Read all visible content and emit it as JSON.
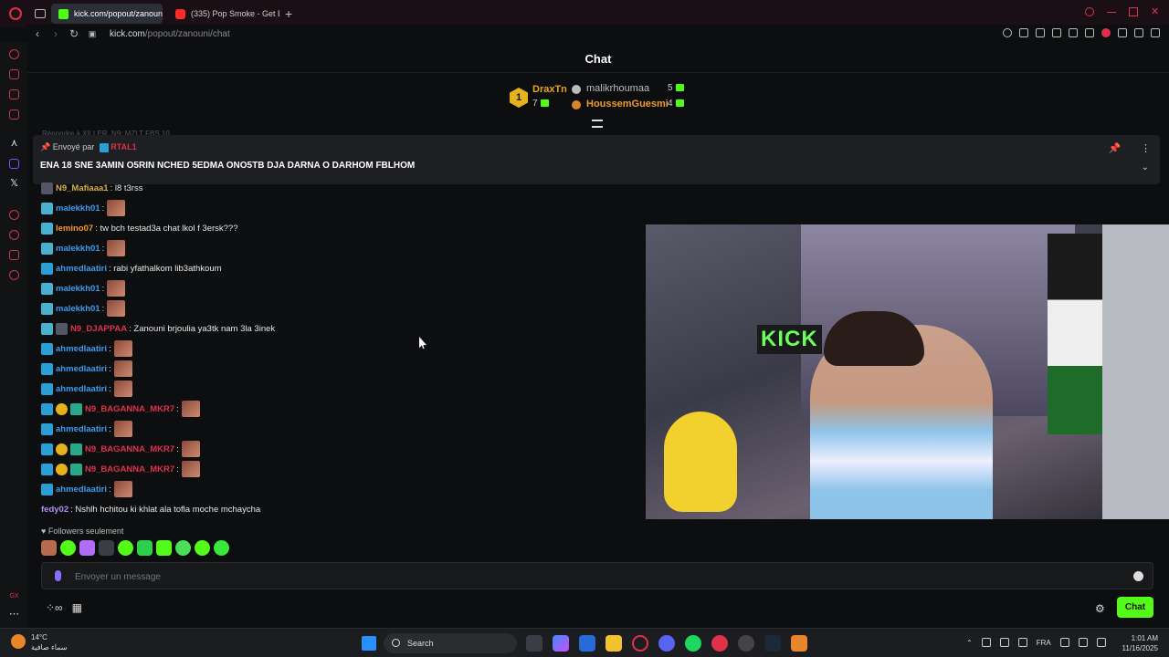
{
  "browser": {
    "tabs": [
      {
        "label": "kick.com/popout/zanouni",
        "active": true
      },
      {
        "label": "(335) Pop Smoke - Get B",
        "active": false
      }
    ],
    "url_host": "kick.com",
    "url_path": "/popout/zanouni/chat"
  },
  "chat": {
    "title": "Chat",
    "leaderboard": {
      "first": {
        "name": "DraxTn",
        "count": "7",
        "rank": "1"
      },
      "second": {
        "name": "malikrhoumaa",
        "count": "5"
      },
      "third": {
        "name": "HoussemGuesmi",
        "count": "4"
      }
    },
    "reply_ghost": "Répondre à XILLER_N9: MZLT FBS 10",
    "pinned": {
      "by_label": "Envoyé par",
      "by_user": "RTAL1",
      "message": "ENA 18 SNE 3AMIN O5RIN NCHED 5EDMA ONO5TB DJA DARNA O DARHOM FBLHOM"
    },
    "messages": [
      {
        "user": "N9_Mafiaaa1",
        "color": "#d6b04a",
        "text": ": l8 t3rss"
      },
      {
        "user": "malekkh01",
        "color": "#3a9cf0",
        "text": ":"
      },
      {
        "user": "lemino07",
        "color": "#f29a2e",
        "text": ": tw bch testad3a chat lkol f 3ersk???"
      },
      {
        "user": "malekkh01",
        "color": "#3a9cf0",
        "text": ":"
      },
      {
        "user": "ahmedlaatiri",
        "color": "#3a9cf0",
        "text": ": rabi yfathalkom lib3athkoum"
      },
      {
        "user": "malekkh01",
        "color": "#3a9cf0",
        "text": ":"
      },
      {
        "user": "malekkh01",
        "color": "#3a9cf0",
        "text": ":"
      },
      {
        "user": "N9_DJAPPAA",
        "color": "#e0314b",
        "text": ": Zanouni brjoulia ya3tk nam 3la 3inek"
      },
      {
        "user": "ahmedlaatiri",
        "color": "#3a9cf0",
        "text": ":"
      },
      {
        "user": "ahmedlaatiri",
        "color": "#3a9cf0",
        "text": ":"
      },
      {
        "user": "ahmedlaatiri",
        "color": "#3a9cf0",
        "text": ":"
      },
      {
        "user": "N9_BAGANNA_MKR7",
        "color": "#e0314b",
        "text": ":"
      },
      {
        "user": "ahmedlaatiri",
        "color": "#3a9cf0",
        "text": ":"
      },
      {
        "user": "N9_BAGANNA_MKR7",
        "color": "#e0314b",
        "text": ":"
      },
      {
        "user": "N9_BAGANNA_MKR7",
        "color": "#e0314b",
        "text": ":"
      },
      {
        "user": "ahmedlaatiri",
        "color": "#3a9cf0",
        "text": ":"
      },
      {
        "user": "fedy02",
        "color": "#b58cf2",
        "text": ": Nshlh hchitou ki khlat ala tofla moche mchaycha"
      }
    ],
    "followers_label": "Followers seulement",
    "input_placeholder": "Envoyer un message",
    "send_button": "Chat",
    "video_overlay_text": "KICK"
  },
  "taskbar": {
    "weather_temp": "14°C",
    "weather_desc": "سماء صافية",
    "search_label": "Search",
    "language": "FRA",
    "time": "1:01 AM",
    "date": "11/16/2025"
  },
  "colors": {
    "accent": "#53fc18",
    "browser_red": "#e0314b",
    "gold": "#e6b21c"
  }
}
